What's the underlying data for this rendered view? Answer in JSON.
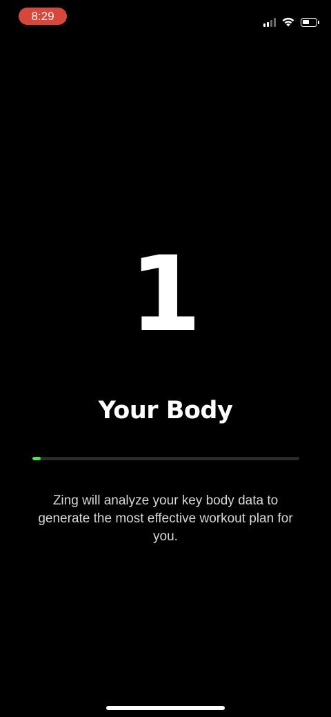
{
  "status_bar": {
    "time": "8:29",
    "time_pill_color": "#d9473a",
    "signal_icon": "cellular-signal-icon",
    "wifi_icon": "wifi-icon",
    "battery_icon": "battery-icon",
    "battery_level": 0.5
  },
  "onboarding": {
    "step_number": "1",
    "step_title": "Your Body",
    "progress": 0.03,
    "progress_color": "#54e34a",
    "description": "Zing will analyze your key body data to generate the most effective workout plan for you."
  }
}
